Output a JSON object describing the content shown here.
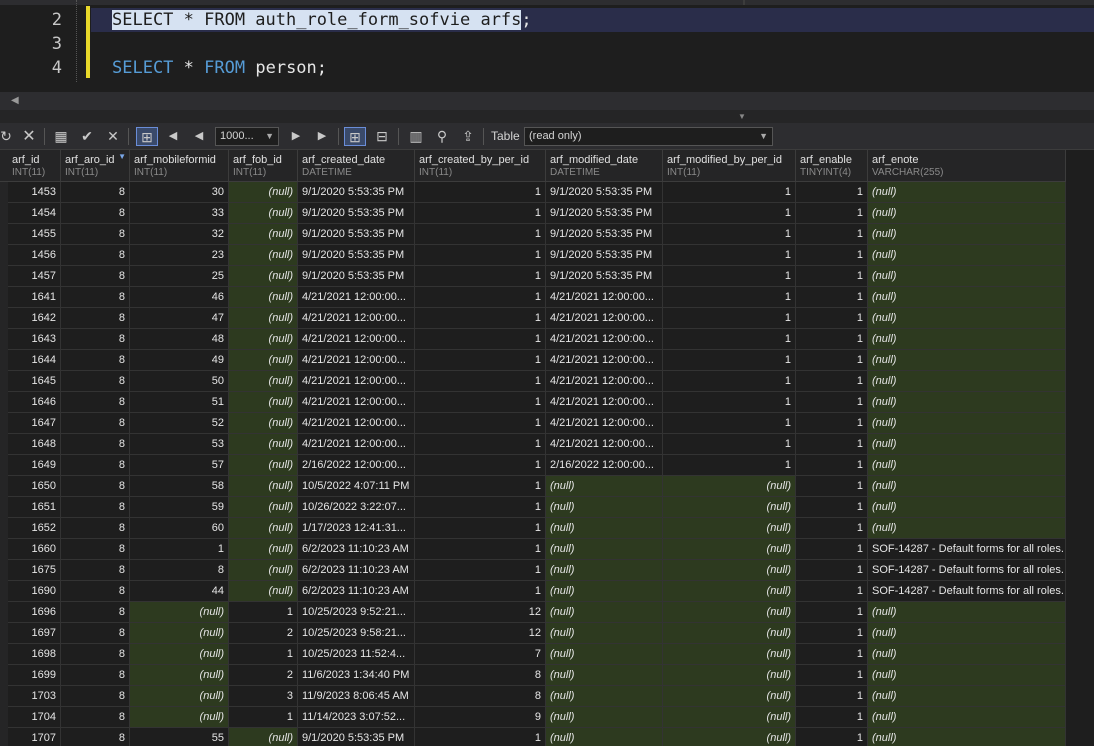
{
  "editor": {
    "lines": [
      {
        "num": "2",
        "parts": [
          {
            "t": "SELECT * FROM auth_role_form_sofvie arfs",
            "c": "sel"
          },
          {
            "t": ";",
            "c": "id"
          }
        ]
      },
      {
        "num": "3",
        "parts": []
      },
      {
        "num": "4",
        "parts": [
          {
            "t": "SELECT",
            "c": "kw"
          },
          {
            "t": " ",
            "c": "id"
          },
          {
            "t": "*",
            "c": "id"
          },
          {
            "t": " ",
            "c": "id"
          },
          {
            "t": "FROM",
            "c": "kw"
          },
          {
            "t": " person",
            "c": "id"
          },
          {
            "t": ";",
            "c": "id"
          }
        ]
      }
    ]
  },
  "toolbar": {
    "limit_value": "1000...",
    "mode_label": "Table",
    "mode_value": "(read only)"
  },
  "columns": [
    {
      "name": "arf_id",
      "type": "INT(11)",
      "w": 53
    },
    {
      "name": "arf_aro_id",
      "type": "INT(11)",
      "w": 69
    },
    {
      "name": "arf_mobileformid",
      "type": "INT(11)",
      "w": 99
    },
    {
      "name": "arf_fob_id",
      "type": "INT(11)",
      "w": 69
    },
    {
      "name": "arf_created_date",
      "type": "DATETIME",
      "w": 117
    },
    {
      "name": "arf_created_by_per_id",
      "type": "INT(11)",
      "w": 131
    },
    {
      "name": "arf_modified_date",
      "type": "DATETIME",
      "w": 117
    },
    {
      "name": "arf_modified_by_per_id",
      "type": "INT(11)",
      "w": 133
    },
    {
      "name": "arf_enable",
      "type": "TINYINT(4)",
      "w": 72
    },
    {
      "name": "arf_enote",
      "type": "VARCHAR(255)",
      "w": 198
    }
  ],
  "rows": [
    [
      "1453",
      "8",
      "30",
      "(null)",
      "9/1/2020 5:53:35 PM",
      "1",
      "9/1/2020 5:53:35 PM",
      "1",
      "1",
      "(null)"
    ],
    [
      "1454",
      "8",
      "33",
      "(null)",
      "9/1/2020 5:53:35 PM",
      "1",
      "9/1/2020 5:53:35 PM",
      "1",
      "1",
      "(null)"
    ],
    [
      "1455",
      "8",
      "32",
      "(null)",
      "9/1/2020 5:53:35 PM",
      "1",
      "9/1/2020 5:53:35 PM",
      "1",
      "1",
      "(null)"
    ],
    [
      "1456",
      "8",
      "23",
      "(null)",
      "9/1/2020 5:53:35 PM",
      "1",
      "9/1/2020 5:53:35 PM",
      "1",
      "1",
      "(null)"
    ],
    [
      "1457",
      "8",
      "25",
      "(null)",
      "9/1/2020 5:53:35 PM",
      "1",
      "9/1/2020 5:53:35 PM",
      "1",
      "1",
      "(null)"
    ],
    [
      "1641",
      "8",
      "46",
      "(null)",
      "4/21/2021 12:00:00...",
      "1",
      "4/21/2021 12:00:00...",
      "1",
      "1",
      "(null)"
    ],
    [
      "1642",
      "8",
      "47",
      "(null)",
      "4/21/2021 12:00:00...",
      "1",
      "4/21/2021 12:00:00...",
      "1",
      "1",
      "(null)"
    ],
    [
      "1643",
      "8",
      "48",
      "(null)",
      "4/21/2021 12:00:00...",
      "1",
      "4/21/2021 12:00:00...",
      "1",
      "1",
      "(null)"
    ],
    [
      "1644",
      "8",
      "49",
      "(null)",
      "4/21/2021 12:00:00...",
      "1",
      "4/21/2021 12:00:00...",
      "1",
      "1",
      "(null)"
    ],
    [
      "1645",
      "8",
      "50",
      "(null)",
      "4/21/2021 12:00:00...",
      "1",
      "4/21/2021 12:00:00...",
      "1",
      "1",
      "(null)"
    ],
    [
      "1646",
      "8",
      "51",
      "(null)",
      "4/21/2021 12:00:00...",
      "1",
      "4/21/2021 12:00:00...",
      "1",
      "1",
      "(null)"
    ],
    [
      "1647",
      "8",
      "52",
      "(null)",
      "4/21/2021 12:00:00...",
      "1",
      "4/21/2021 12:00:00...",
      "1",
      "1",
      "(null)"
    ],
    [
      "1648",
      "8",
      "53",
      "(null)",
      "4/21/2021 12:00:00...",
      "1",
      "4/21/2021 12:00:00...",
      "1",
      "1",
      "(null)"
    ],
    [
      "1649",
      "8",
      "57",
      "(null)",
      "2/16/2022 12:00:00...",
      "1",
      "2/16/2022 12:00:00...",
      "1",
      "1",
      "(null)"
    ],
    [
      "1650",
      "8",
      "58",
      "(null)",
      "10/5/2022 4:07:11 PM",
      "1",
      "(null)",
      "(null)",
      "1",
      "(null)"
    ],
    [
      "1651",
      "8",
      "59",
      "(null)",
      "10/26/2022 3:22:07...",
      "1",
      "(null)",
      "(null)",
      "1",
      "(null)"
    ],
    [
      "1652",
      "8",
      "60",
      "(null)",
      "1/17/2023 12:41:31...",
      "1",
      "(null)",
      "(null)",
      "1",
      "(null)"
    ],
    [
      "1660",
      "8",
      "1",
      "(null)",
      "6/2/2023 11:10:23 AM",
      "1",
      "(null)",
      "(null)",
      "1",
      "SOF-14287 - Default forms for all roles."
    ],
    [
      "1675",
      "8",
      "8",
      "(null)",
      "6/2/2023 11:10:23 AM",
      "1",
      "(null)",
      "(null)",
      "1",
      "SOF-14287 - Default forms for all roles."
    ],
    [
      "1690",
      "8",
      "44",
      "(null)",
      "6/2/2023 11:10:23 AM",
      "1",
      "(null)",
      "(null)",
      "1",
      "SOF-14287 - Default forms for all roles."
    ],
    [
      "1696",
      "8",
      "(null)",
      "1",
      "10/25/2023 9:52:21...",
      "12",
      "(null)",
      "(null)",
      "1",
      "(null)"
    ],
    [
      "1697",
      "8",
      "(null)",
      "2",
      "10/25/2023 9:58:21...",
      "12",
      "(null)",
      "(null)",
      "1",
      "(null)"
    ],
    [
      "1698",
      "8",
      "(null)",
      "1",
      "10/25/2023 11:52:4...",
      "7",
      "(null)",
      "(null)",
      "1",
      "(null)"
    ],
    [
      "1699",
      "8",
      "(null)",
      "2",
      "11/6/2023 1:34:40 PM",
      "8",
      "(null)",
      "(null)",
      "1",
      "(null)"
    ],
    [
      "1703",
      "8",
      "(null)",
      "3",
      "11/9/2023 8:06:45 AM",
      "8",
      "(null)",
      "(null)",
      "1",
      "(null)"
    ],
    [
      "1704",
      "8",
      "(null)",
      "1",
      "11/14/2023 3:07:52...",
      "9",
      "(null)",
      "(null)",
      "1",
      "(null)"
    ],
    [
      "1707",
      "8",
      "55",
      "(null)",
      "9/1/2020 5:53:35 PM",
      "1",
      "(null)",
      "(null)",
      "1",
      "(null)"
    ]
  ]
}
